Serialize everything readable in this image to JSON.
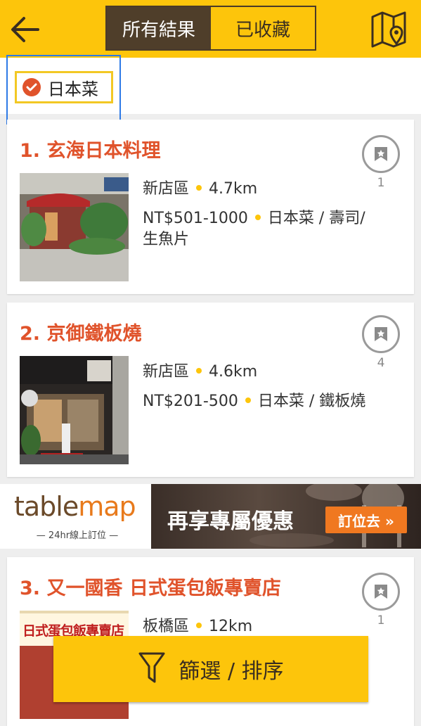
{
  "header": {
    "tabs": [
      {
        "label": "所有結果",
        "active": true
      },
      {
        "label": "已收藏",
        "active": false
      }
    ]
  },
  "filter": {
    "chip_label": "日本菜"
  },
  "restaurants": [
    {
      "title": "1. 玄海日本料理",
      "district": "新店區",
      "distance": "4.7km",
      "price": "NT$501-1000",
      "cuisine_line1": "日本菜 / 壽司/",
      "cuisine_line2": "生魚片",
      "bookmark_count": "1"
    },
    {
      "title": "2. 京御鐵板燒",
      "district": "新店區",
      "distance": "4.6km",
      "price": "NT$201-500",
      "cuisine_line1": "日本菜 / 鐵板燒",
      "bookmark_count": "4"
    },
    {
      "title": "3. 又一國香 日式蛋包飯專賣店",
      "district": "板橋區",
      "distance": "12km",
      "bookmark_count": "1",
      "sign_text": "日式蛋包飯專賣店"
    }
  ],
  "ad": {
    "logo_part1": "table",
    "logo_part2": "map",
    "subtitle": "— 24hr線上訂位 —",
    "slogan": "再享專屬優惠",
    "button": "訂位去 »"
  },
  "sort_bar": {
    "label": "篩選 / 排序"
  },
  "colors": {
    "brand_yellow": "#fdc50b",
    "title_red": "#e0532b",
    "tab_brown": "#4f3e2a",
    "ad_orange": "#f07820"
  }
}
